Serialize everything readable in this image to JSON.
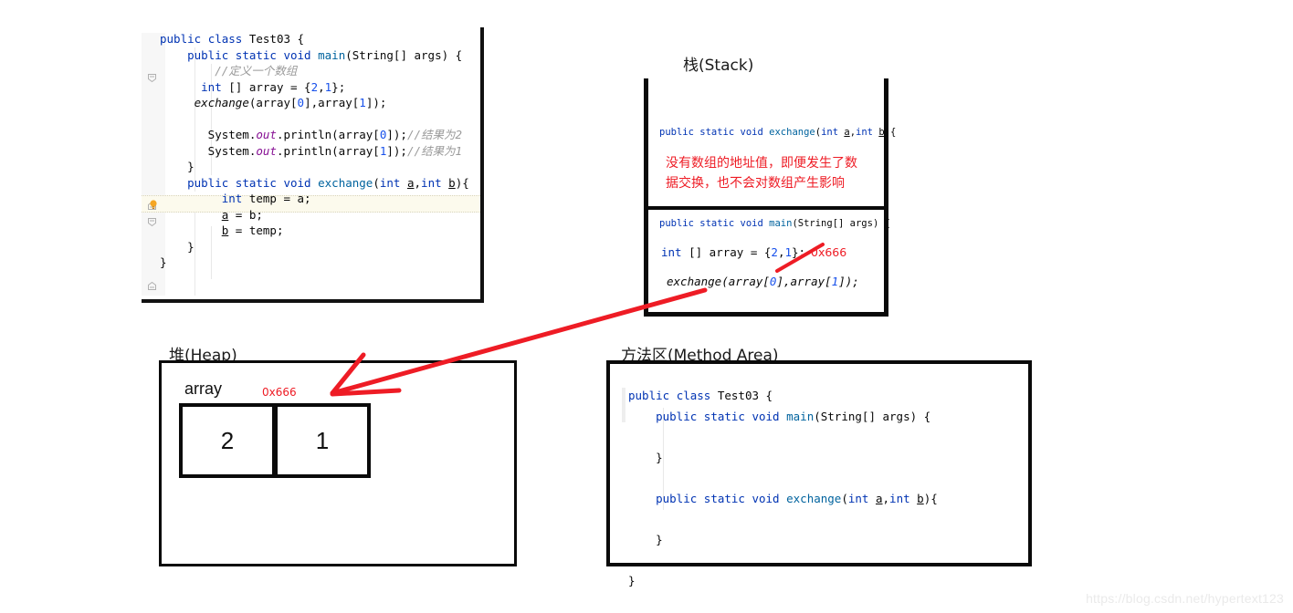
{
  "watermark": "https://blog.csdn.net/hypertext123",
  "editor": {
    "lines": [
      "public class Test03 {",
      "    public static void main(String[] args) {",
      "        //定义一个数组",
      "      int [] array = {2,1};",
      "     exchange(array[0],array[1]);",
      "",
      "       System.out.println(array[0]);//结果为2",
      "       System.out.println(array[1]);//结果为1",
      "    }",
      "    public static void exchange(int a,int b){",
      "         int temp = a;",
      "         a = b;",
      "         b = temp;",
      "    }",
      "}"
    ],
    "bulb_icon": "lightbulb-icon",
    "fold_icon": "code-fold-icon"
  },
  "stack": {
    "title": "栈(Stack)",
    "frames": [
      {
        "name": "exchange-frame",
        "signature": "public static void exchange(int a,int b){",
        "note": "没有数组的地址值，即便发生了数\n据交换，也不会对数组产生影响"
      },
      {
        "name": "main-frame",
        "signature": "public static void main(String[] args) {",
        "declaration": "int [] array = {2,1};",
        "address": "0x666",
        "call": "exchange(array[0],array[1]);"
      }
    ]
  },
  "heap": {
    "title": "堆(Heap)",
    "array_label": "array",
    "array_address": "0x666",
    "cells": [
      "2",
      "1"
    ]
  },
  "method_area": {
    "title": "方法区(Method Area)",
    "lines": [
      "public class Test03 {",
      "    public static void main(String[] args) {",
      "",
      "    }",
      "",
      "    public static void exchange(int a,int b){",
      "",
      "    }",
      "",
      "}"
    ]
  },
  "colors": {
    "accent_red": "#ee1c25",
    "keyword_blue": "#0033b3",
    "method_blue": "#00639e",
    "number_blue": "#1750eb",
    "comment_gray": "#9a9a9a",
    "border_black": "#0a0a0a"
  },
  "arrows": [
    {
      "name": "stack-to-heap-arrow",
      "from": "main-frame exchange call",
      "to": "heap array block",
      "color": "#ee1c25"
    },
    {
      "name": "address-pointer-arrow",
      "from": "exchange call",
      "to": "0x666 address literal",
      "color": "#ee1c25"
    }
  ]
}
